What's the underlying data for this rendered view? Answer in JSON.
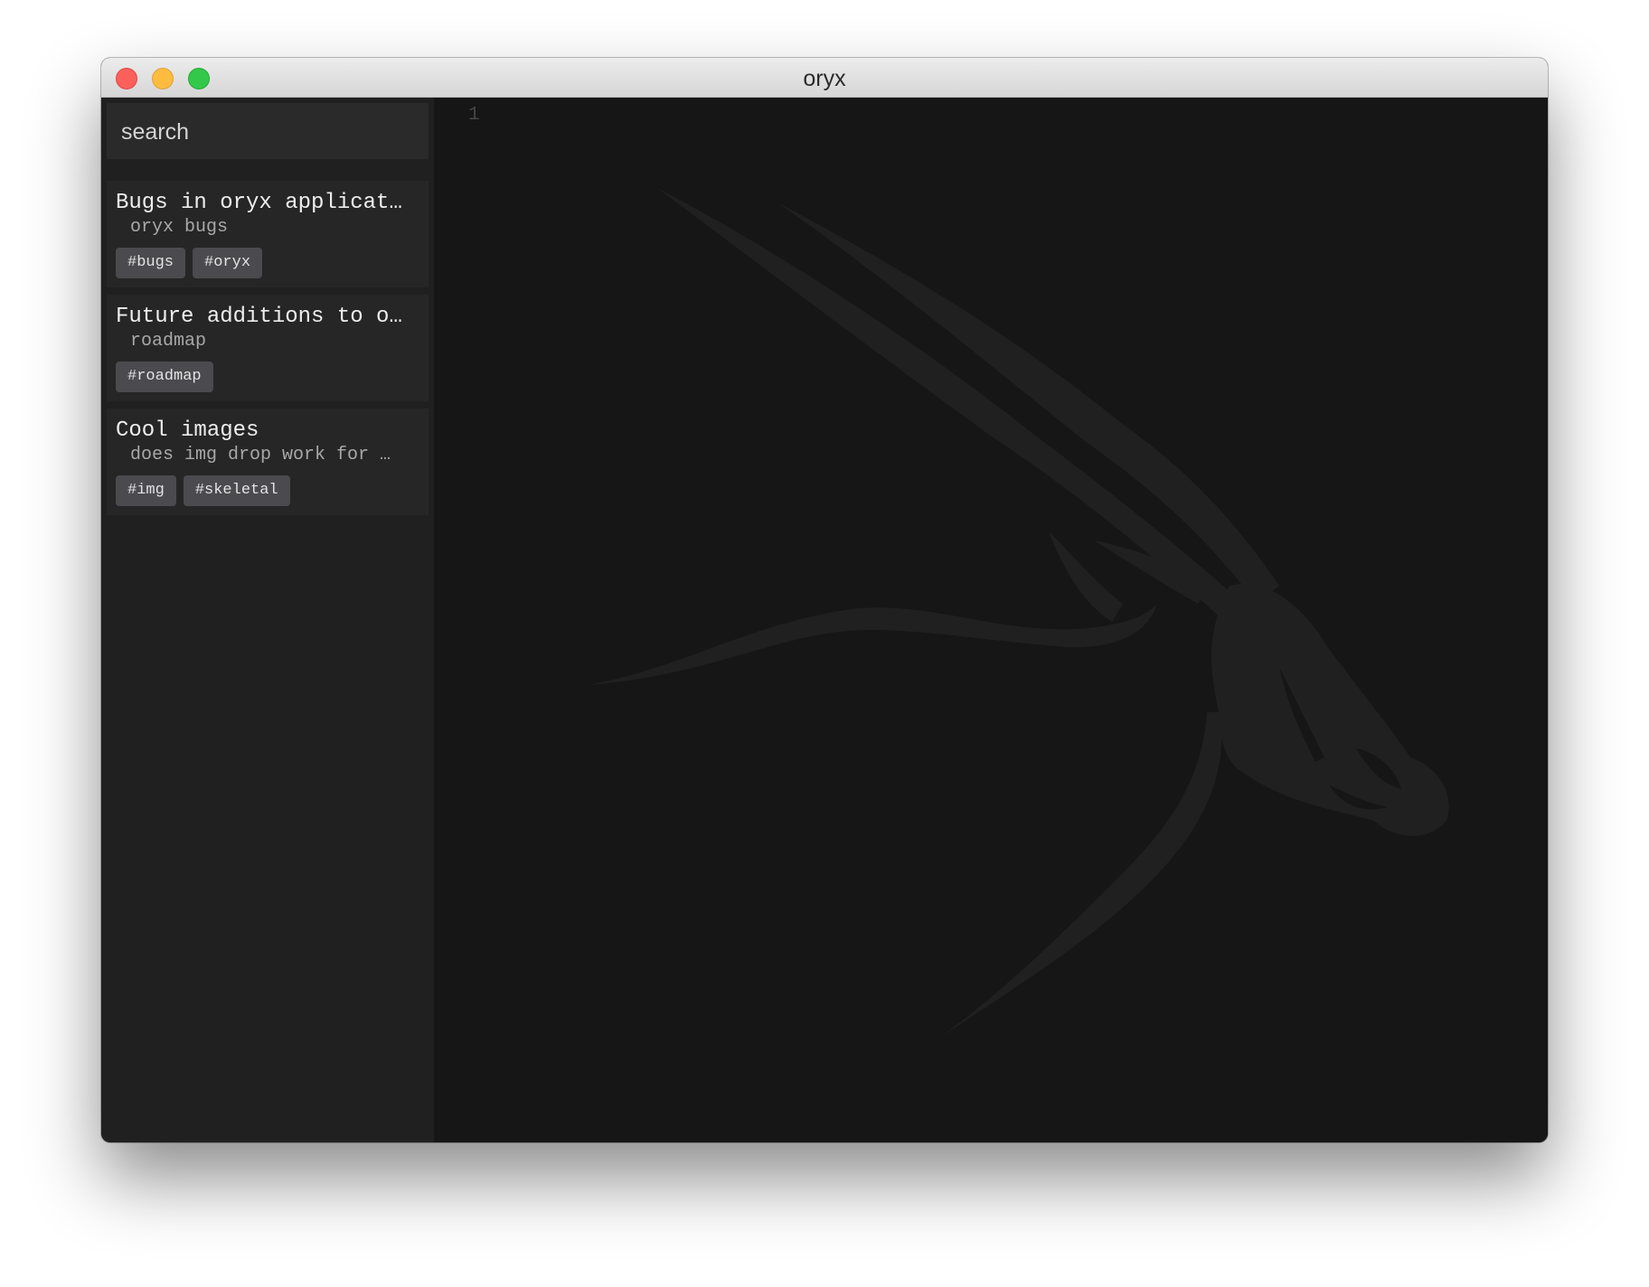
{
  "window": {
    "title": "oryx",
    "controls": {
      "close": "close-icon",
      "minimize": "minimize-icon",
      "zoom": "zoom-icon"
    }
  },
  "sidebar": {
    "search": {
      "placeholder": "search"
    },
    "notes": [
      {
        "title": "Bugs in oryx applicat…",
        "preview": "oryx bugs",
        "tags": [
          "#bugs",
          "#oryx"
        ]
      },
      {
        "title": "Future additions to o…",
        "preview": "roadmap",
        "tags": [
          "#roadmap"
        ]
      },
      {
        "title": "Cool images",
        "preview": "does img drop work for …",
        "tags": [
          "#img",
          "#skeletal"
        ]
      }
    ]
  },
  "editor": {
    "line_numbers": [
      "1"
    ],
    "watermark": "oryx-logo-icon"
  },
  "colors": {
    "sidebar_bg": "#202020",
    "editor_bg": "#161616",
    "tag_bg": "#4a4a4f",
    "close": "#fc605b",
    "minimize": "#fdbc40",
    "zoom": "#34c84a"
  }
}
